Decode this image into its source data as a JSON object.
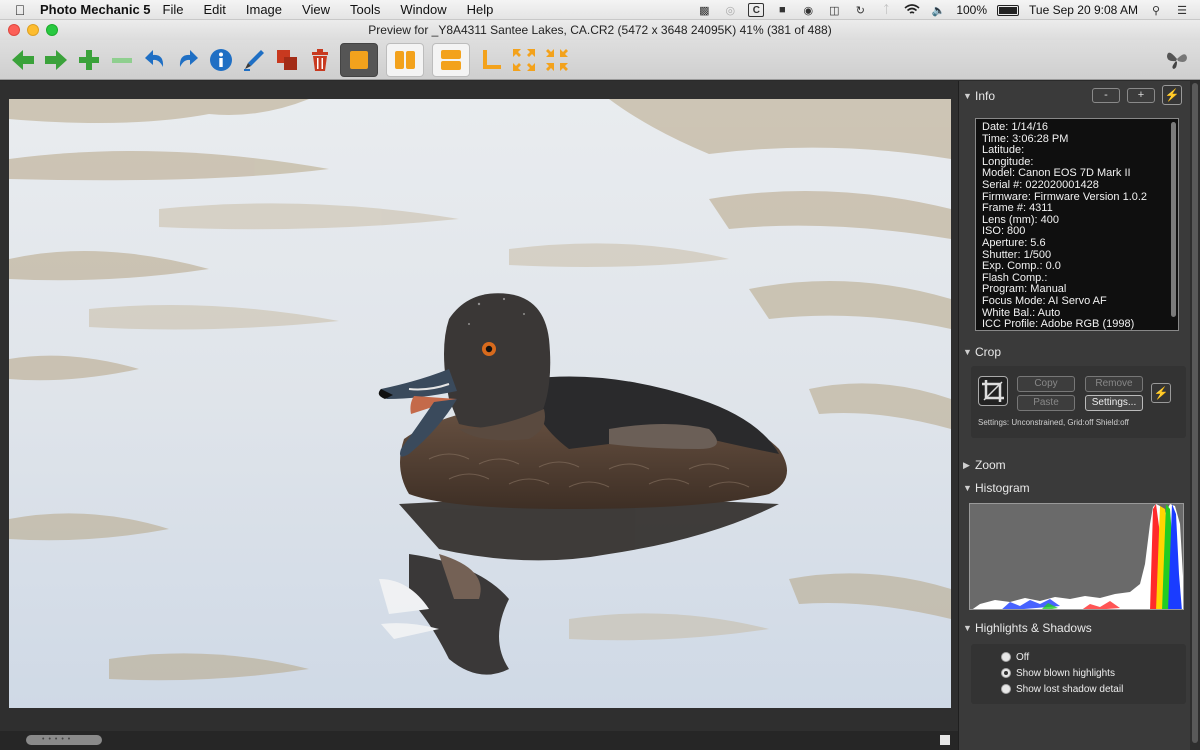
{
  "menubar": {
    "app_name": "Photo Mechanic 5",
    "items": [
      "File",
      "Edit",
      "Image",
      "View",
      "Tools",
      "Window",
      "Help"
    ],
    "status_icon_c": "C",
    "battery_percent": "100%",
    "datetime": "Tue Sep 20  9:08 AM"
  },
  "window": {
    "title": "Preview for _Y8A4311  Santee Lakes, CA.CR2 (5472 x 3648 24095K) 41% (381 of 488)"
  },
  "toolbar": {
    "icons": [
      "back-arrow-icon",
      "forward-arrow-icon",
      "plus-icon",
      "minus-icon",
      "rotate-left-icon",
      "rotate-right-icon",
      "info-icon",
      "edit-pen-icon",
      "copy-icon",
      "trash-icon",
      "single-view-icon",
      "side-by-side-icon",
      "stacked-icon",
      "corner-icon",
      "zoom-in-icon",
      "zoom-out-icon"
    ]
  },
  "panel": {
    "info": {
      "title": "Info",
      "minus_label": "-",
      "plus_label": "+",
      "lines": [
        "Date: 1/14/16",
        "Time: 3:06:28 PM",
        "Latitude:",
        "Longitude:",
        "Model: Canon EOS 7D Mark II",
        "Serial #: 022020001428",
        "Firmware: Firmware Version 1.0.2",
        "Frame #: 4311",
        "Lens (mm): 400",
        "ISO: 800",
        "Aperture: 5.6",
        "Shutter: 1/500",
        "Exp. Comp.: 0.0",
        "Flash Comp.:",
        "Program: Manual",
        "Focus Mode: AI Servo AF",
        "White Bal.: Auto",
        "ICC Profile: Adobe RGB (1998)"
      ]
    },
    "crop": {
      "title": "Crop",
      "copy_label": "Copy",
      "remove_label": "Remove",
      "paste_label": "Paste",
      "settings_label": "Settings...",
      "settings_text": "Settings:   Unconstrained, Grid:off Shield:off"
    },
    "zoom": {
      "title": "Zoom"
    },
    "histogram": {
      "title": "Histogram"
    },
    "highlights": {
      "title": "Highlights & Shadows",
      "options": [
        "Off",
        "Show blown highlights",
        "Show lost shadow detail"
      ],
      "selected_index": 1
    }
  },
  "colors": {
    "panel_bg": "#3a3a3a",
    "toolbar_green": "#3aa23a",
    "toolbar_blue": "#1f6fc4",
    "toolbar_orange": "#f3a21c",
    "toolbar_red": "#c8391f"
  }
}
